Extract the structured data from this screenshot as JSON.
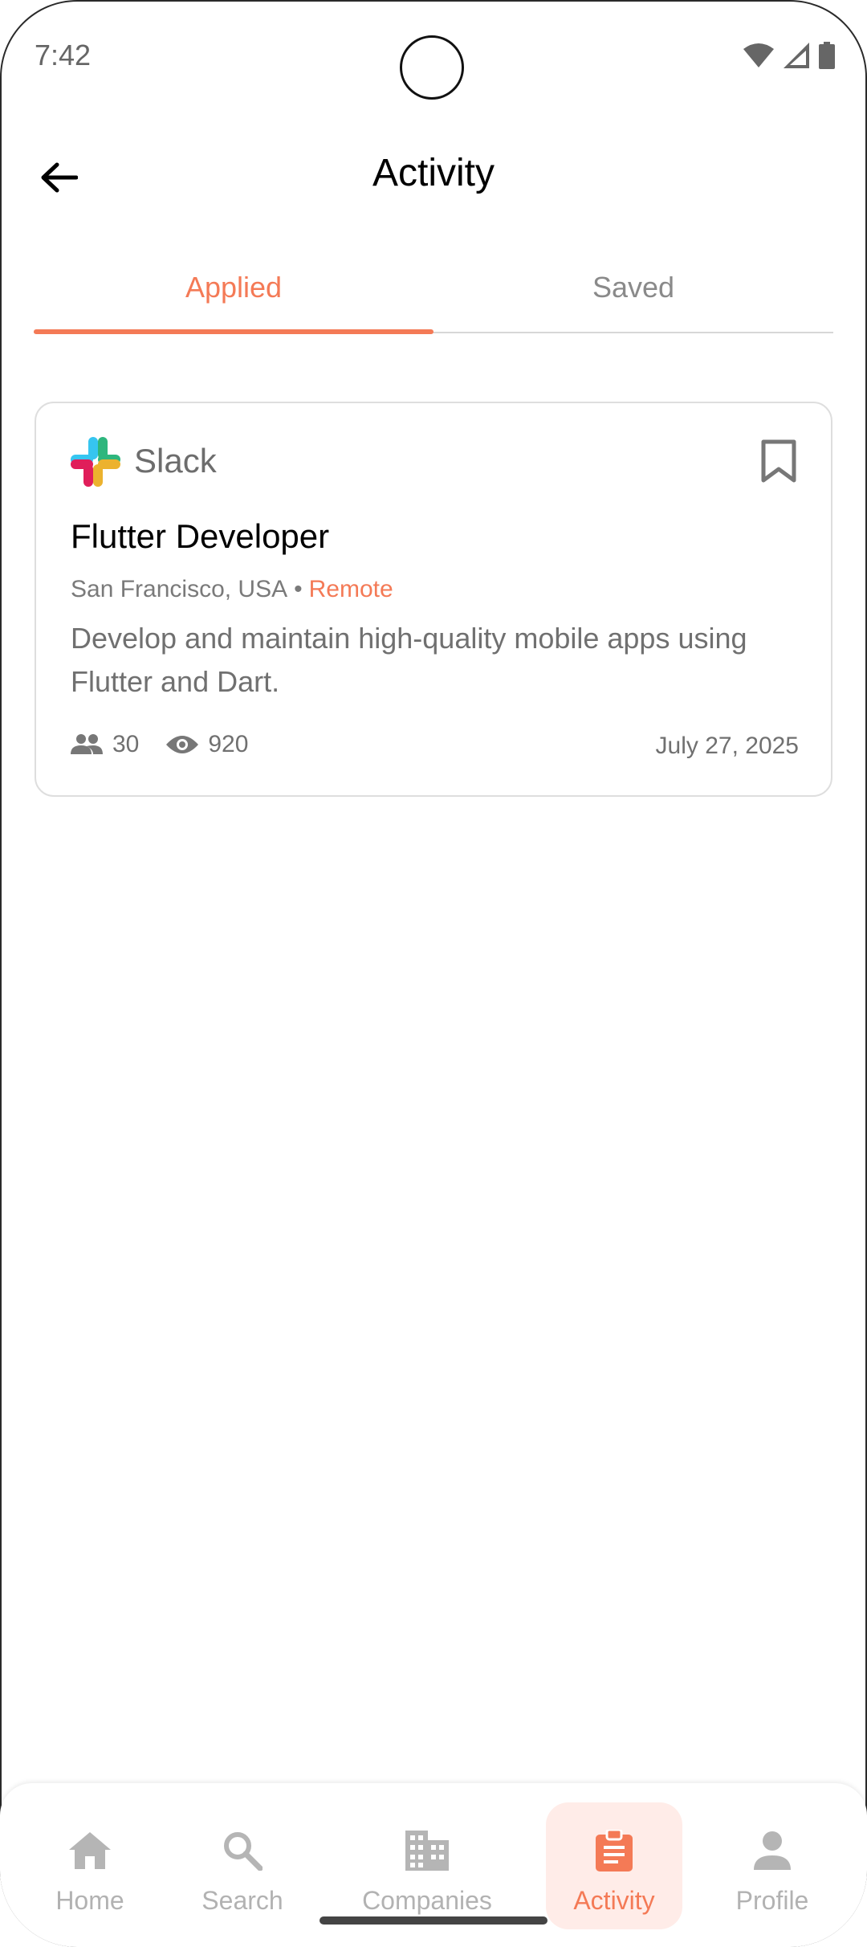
{
  "status_bar": {
    "time": "7:42"
  },
  "header": {
    "title": "Activity"
  },
  "tabs": [
    {
      "label": "Applied",
      "active": true
    },
    {
      "label": "Saved",
      "active": false
    }
  ],
  "job_card": {
    "company": "Slack",
    "title": "Flutter Developer",
    "location": "San Francisco, USA",
    "separator": "•",
    "work_type": "Remote",
    "description": "Develop and maintain high-quality mobile apps using Flutter and Dart.",
    "applicants": "30",
    "views": "920",
    "date": "July 27, 2025"
  },
  "bottom_nav": [
    {
      "label": "Home",
      "icon": "home-icon",
      "active": false
    },
    {
      "label": "Search",
      "icon": "search-icon",
      "active": false
    },
    {
      "label": "Companies",
      "icon": "companies-icon",
      "active": false
    },
    {
      "label": "Activity",
      "icon": "activity-icon",
      "active": true
    },
    {
      "label": "Profile",
      "icon": "profile-icon",
      "active": false
    }
  ],
  "colors": {
    "accent": "#f47a56",
    "muted": "#8a8a8a"
  }
}
